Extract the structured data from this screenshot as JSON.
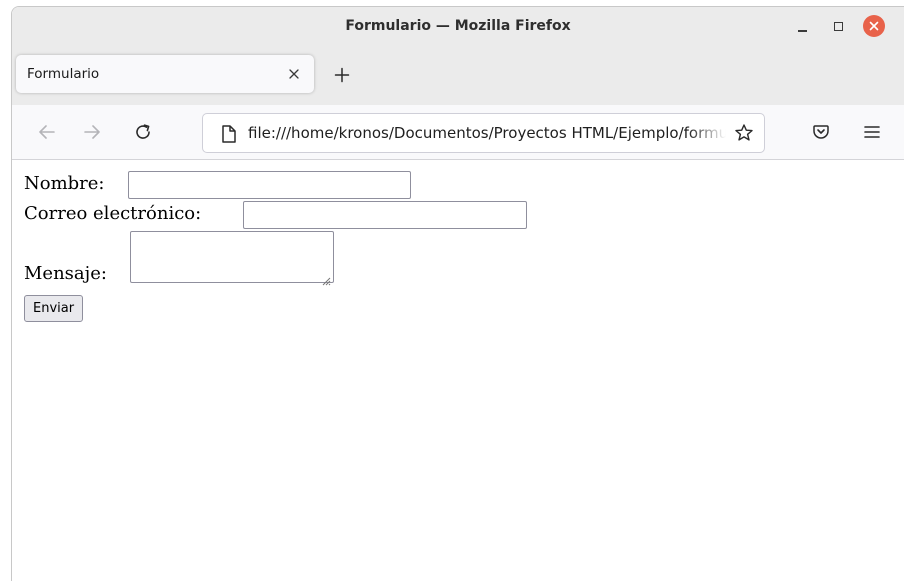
{
  "window": {
    "title": "Formulario — Mozilla Firefox",
    "close_color": "#e8624a"
  },
  "tabs": [
    {
      "label": "Formulario",
      "active": true
    }
  ],
  "navbar": {
    "url": "file:///home/kronos/Documentos/Proyectos HTML/Ejemplo/formulario.html",
    "icons": [
      "back-arrow-icon",
      "forward-arrow-icon",
      "reload-icon",
      "page-icon",
      "bookmark-star-icon",
      "pocket-icon",
      "menu-icon"
    ]
  },
  "form": {
    "name_label": "Nombre:",
    "name_value": "",
    "email_label": "Correo electrónico:",
    "email_value": "",
    "message_label": "Mensaje:",
    "message_value": "",
    "submit_label": "Enviar"
  }
}
